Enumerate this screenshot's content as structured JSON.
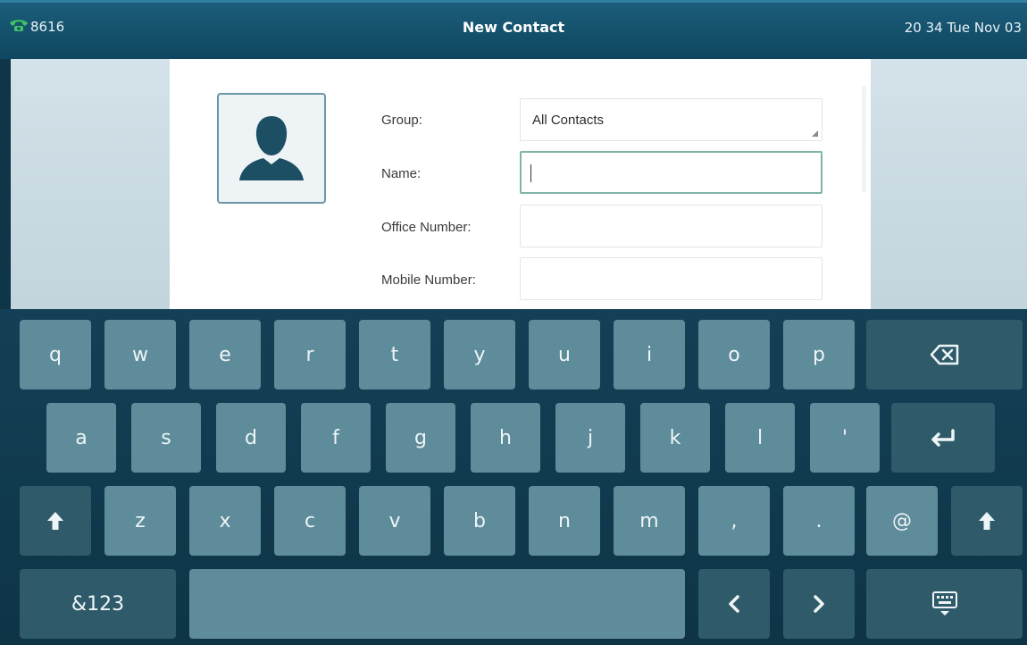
{
  "status_bar": {
    "line_number": "8616",
    "title": "New Contact",
    "datetime": "20 34 Tue Nov 03"
  },
  "form": {
    "group_label": "Group:",
    "group_value": "All Contacts",
    "name_label": "Name:",
    "name_value": "",
    "office_label": "Office Number:",
    "office_value": "",
    "mobile_label": "Mobile Number:",
    "mobile_value": ""
  },
  "keyboard": {
    "row1": [
      "q",
      "w",
      "e",
      "r",
      "t",
      "y",
      "u",
      "i",
      "o",
      "p"
    ],
    "row2": [
      "a",
      "s",
      "d",
      "f",
      "g",
      "h",
      "j",
      "k",
      "l",
      "'"
    ],
    "row3": [
      "z",
      "x",
      "c",
      "v",
      "b",
      "n",
      "m",
      ",",
      "."
    ],
    "at_key": "@",
    "symbols_key": "&123",
    "icons": {
      "backspace": "backspace-icon",
      "enter": "enter-icon",
      "shift": "shift-icon",
      "left": "arrow-left-icon",
      "right": "arrow-right-icon",
      "hide": "keyboard-hide-icon"
    }
  },
  "colors": {
    "key": "#5e8c9a",
    "key_dark": "#2f5a6a",
    "status_bar": "#14506b",
    "phone_icon": "#3fc463"
  }
}
